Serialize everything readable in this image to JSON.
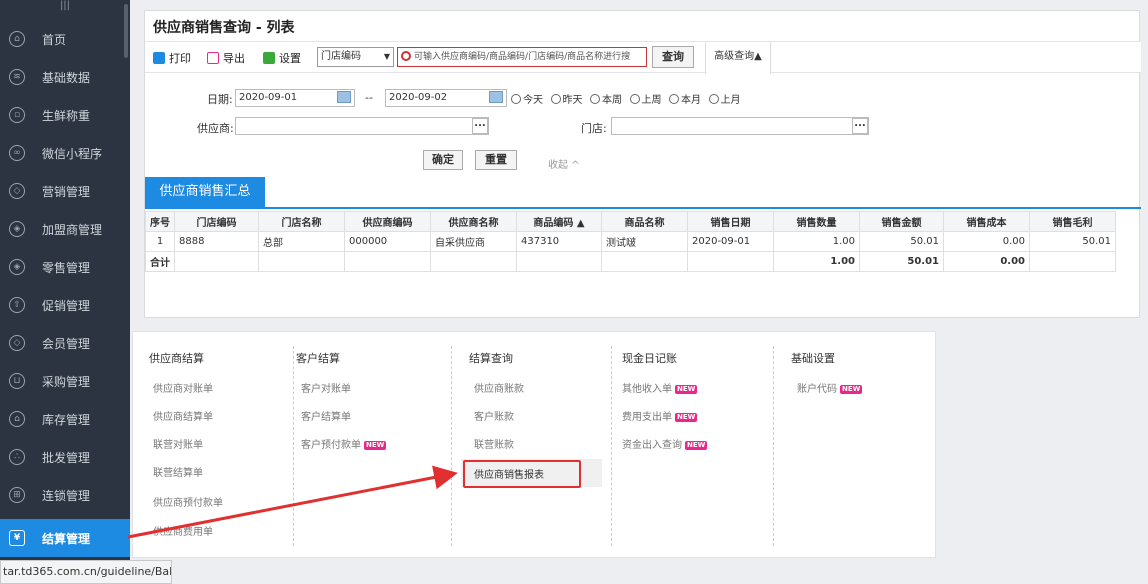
{
  "sidebar": {
    "items": [
      {
        "label": "首页",
        "icon": "home-icon"
      },
      {
        "label": "基础数据",
        "icon": "layers-icon"
      },
      {
        "label": "生鲜称重",
        "icon": "scale-icon"
      },
      {
        "label": "微信小程序",
        "icon": "miniprogram-icon"
      },
      {
        "label": "营销管理",
        "icon": "diamond-icon"
      },
      {
        "label": "加盟商管理",
        "icon": "tag-icon"
      },
      {
        "label": "零售管理",
        "icon": "tag-icon"
      },
      {
        "label": "促销管理",
        "icon": "arrow-icon"
      },
      {
        "label": "会员管理",
        "icon": "diamond-icon"
      },
      {
        "label": "采购管理",
        "icon": "cart-icon"
      },
      {
        "label": "库存管理",
        "icon": "warehouse-icon"
      },
      {
        "label": "批发管理",
        "icon": "cluster-icon"
      },
      {
        "label": "连锁管理",
        "icon": "chain-icon"
      },
      {
        "label": "结算管理",
        "icon": "yen-icon"
      }
    ]
  },
  "statusbar": "tar.td365.com.cn/guideline/Balance",
  "page": {
    "title": "供应商销售查询 - 列表",
    "toolbar": {
      "print": "打印",
      "export": "导出",
      "settings": "设置",
      "select_value": "门店编码",
      "search_placeholder": "可输入供应商编码/商品编码/门店编码/商品名称进行搜",
      "query": "查询",
      "advanced": "高级查询▲"
    },
    "filters": {
      "date_label": "日期:",
      "date_from": "2020-09-01",
      "date_sep": "--",
      "date_to": "2020-09-02",
      "radios": [
        "今天",
        "昨天",
        "本周",
        "上周",
        "本月",
        "上月"
      ],
      "supplier_label": "供应商:",
      "store_label": "门店:",
      "ok": "确定",
      "reset": "重置",
      "collapse": "收起 ^"
    },
    "summary_tab": "供应商销售汇总",
    "table": {
      "headers": [
        "序号",
        "门店编码",
        "门店名称",
        "供应商编码",
        "供应商名称",
        "商品编码 ▲",
        "商品名称",
        "销售日期",
        "销售数量",
        "销售金额",
        "销售成本",
        "销售毛利"
      ],
      "rows": [
        [
          "1",
          "8888",
          "总部",
          "000000",
          "自采供应商",
          "437310",
          "测试啵",
          "2020-09-01",
          "1.00",
          "50.01",
          "0.00",
          "50.01"
        ]
      ],
      "total": {
        "label": "合计",
        "qty": "1.00",
        "amount": "50.01",
        "cost": "0.00"
      }
    }
  },
  "menu": {
    "columns": [
      {
        "title": "供应商结算",
        "items": [
          {
            "label": "供应商对账单"
          },
          {
            "label": "供应商结算单"
          },
          {
            "label": "联营对账单"
          },
          {
            "label": "联营结算单"
          },
          {
            "label": "供应商预付款单"
          },
          {
            "label": "供应商费用单"
          }
        ]
      },
      {
        "title": "客户结算",
        "items": [
          {
            "label": "客户对账单"
          },
          {
            "label": "客户结算单"
          },
          {
            "label": "客户预付款单",
            "new": "NEW"
          }
        ]
      },
      {
        "title": "结算查询",
        "items": [
          {
            "label": "供应商账款"
          },
          {
            "label": "客户账款"
          },
          {
            "label": "联营账款"
          },
          {
            "label": "供应商销售报表"
          }
        ]
      },
      {
        "title": "现金日记账",
        "items": [
          {
            "label": "其他收入单",
            "new": "NEW"
          },
          {
            "label": "费用支出单",
            "new": "NEW"
          },
          {
            "label": "资金出入查询",
            "new": "NEW"
          }
        ]
      },
      {
        "title": "基础设置",
        "items": [
          {
            "label": "账户代码",
            "new": "NEW"
          }
        ]
      }
    ]
  },
  "colors": {
    "accent": "#1e8be2",
    "sidebar": "#2b3440",
    "highlight": "#e03030",
    "new_badge": "#e8288c"
  }
}
